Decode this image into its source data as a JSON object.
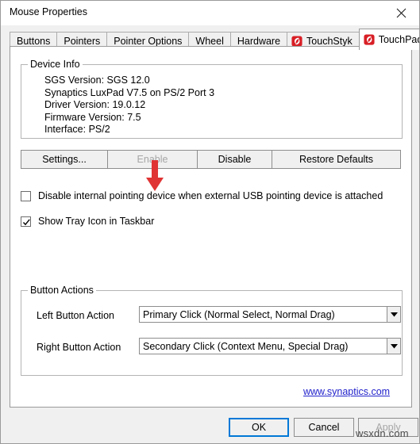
{
  "window": {
    "title": "Mouse Properties",
    "close_icon": "close-icon"
  },
  "tabs": [
    {
      "label": "Buttons",
      "icon": null,
      "active": false
    },
    {
      "label": "Pointers",
      "icon": null,
      "active": false
    },
    {
      "label": "Pointer Options",
      "icon": null,
      "active": false
    },
    {
      "label": "Wheel",
      "icon": null,
      "active": false
    },
    {
      "label": "Hardware",
      "icon": null,
      "active": false
    },
    {
      "label": "TouchStyk",
      "icon": "synaptics-icon",
      "active": false
    },
    {
      "label": "TouchPad",
      "icon": "synaptics-icon",
      "active": true
    }
  ],
  "device_info": {
    "group_title": "Device Info",
    "lines": [
      "SGS Version: SGS 12.0",
      "Synaptics LuxPad V7.5 on PS/2 Port 3",
      "Driver Version: 19.0.12",
      "Firmware Version: 7.5",
      "Interface: PS/2"
    ]
  },
  "annotation": {
    "arrow_color": "#e03434",
    "name": "red-down-arrow"
  },
  "device_buttons": [
    {
      "label": "Settings...",
      "id": "settings",
      "disabled": false
    },
    {
      "label": "Enable",
      "id": "enable",
      "disabled": true
    },
    {
      "label": "Disable",
      "id": "disable",
      "disabled": false
    },
    {
      "label": "Restore Defaults",
      "id": "restore",
      "disabled": false
    }
  ],
  "checkboxes": [
    {
      "label": "Disable internal pointing device when external USB pointing device is attached",
      "checked": false
    },
    {
      "label": "Show Tray Icon in Taskbar",
      "checked": true
    }
  ],
  "button_actions": {
    "group_title": "Button Actions",
    "left_label": "Left Button Action",
    "left_value": "Primary Click (Normal Select, Normal Drag)",
    "right_label": "Right Button Action",
    "right_value": "Secondary Click (Context Menu, Special Drag)"
  },
  "link": {
    "text": "www.synaptics.com",
    "color": "#2222cc"
  },
  "footer": {
    "ok": "OK",
    "cancel": "Cancel",
    "apply": "Apply",
    "apply_disabled": true,
    "ok_default": true
  },
  "watermark": {
    "text": "wsxdn.com"
  }
}
